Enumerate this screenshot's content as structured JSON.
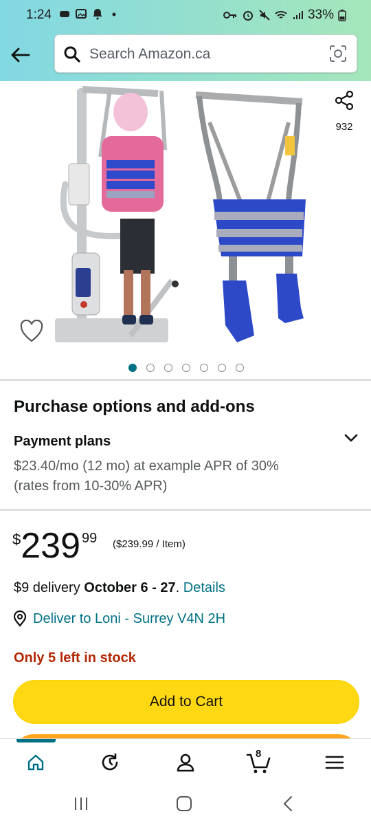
{
  "status_bar": {
    "time": "1:24",
    "battery": "33%"
  },
  "search": {
    "placeholder": "Search Amazon.ca"
  },
  "gallery": {
    "share_count": "932",
    "image_count": 7,
    "active_index": 0
  },
  "purchase": {
    "section_title": "Purchase options and add-ons",
    "payment_plans_title": "Payment plans",
    "payment_plans_text": "$23.40/mo (12 mo) at example APR of 30% (rates from 10-30% APR)"
  },
  "price": {
    "currency": "$",
    "whole": "239",
    "fraction": "99",
    "unit_price": "($239.99 / Item)"
  },
  "delivery": {
    "prefix": "$9 delivery ",
    "dates": "October 6 - 27",
    "separator": ". ",
    "details_link": "Details",
    "deliver_to": "Deliver to Loni - Surrey V4N 2H"
  },
  "stock": {
    "text": "Only 5 left in stock"
  },
  "actions": {
    "add_to_cart": "Add to Cart"
  },
  "bottom_nav": {
    "cart_count": "8"
  },
  "colors": {
    "accent_teal": "#007185",
    "add_to_cart_yellow": "#ffd814",
    "buy_now_orange": "#ffa41c",
    "stock_red": "#b12704"
  },
  "icons": [
    "back-arrow-icon",
    "search-icon",
    "camera-lens-icon",
    "share-icon",
    "heart-icon",
    "chevron-down-icon",
    "location-pin-icon",
    "home-icon",
    "refresh-history-icon",
    "account-icon",
    "cart-icon",
    "menu-icon"
  ]
}
